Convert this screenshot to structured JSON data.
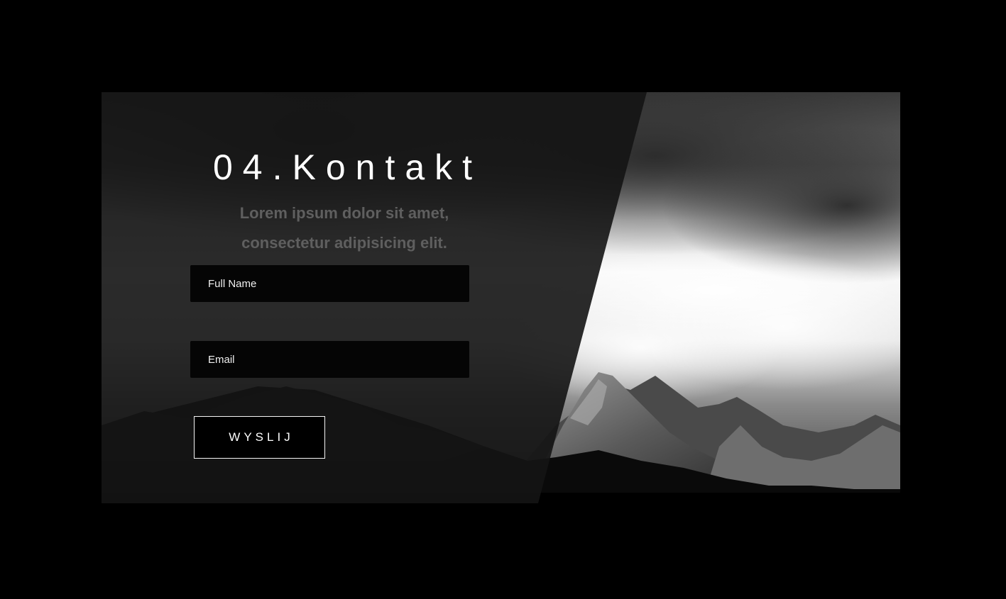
{
  "section": {
    "title": "04.Kontakt",
    "subtitle_line1": "Lorem ipsum dolor sit amet,",
    "subtitle_line2": "consectetur adipisicing elit."
  },
  "form": {
    "name_placeholder": "Full Name",
    "email_placeholder": "Email",
    "submit_label": "WYSLIJ"
  },
  "colors": {
    "background": "#000000",
    "panel_overlay": "#141414",
    "title": "#ffffff",
    "subtitle": "#5f5f5f",
    "input_background": "#050505",
    "button_border": "#f5f5f5"
  }
}
